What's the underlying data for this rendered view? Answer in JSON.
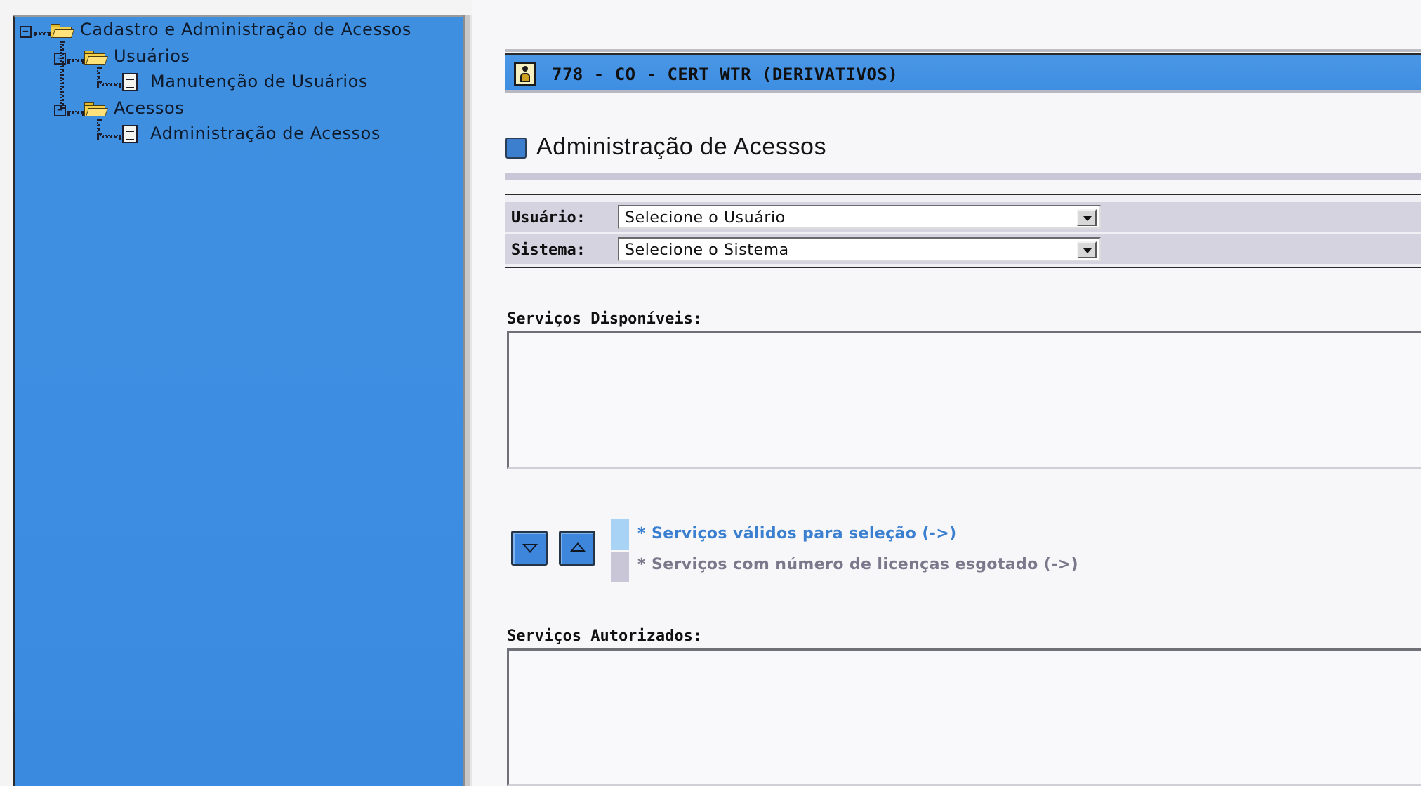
{
  "tree": {
    "root": {
      "toggle": "−",
      "label": "Cadastro e Administração de Acessos"
    },
    "usuarios": {
      "toggle": "−",
      "label": "Usuários"
    },
    "manutencao": {
      "label": "Manutenção de Usuários"
    },
    "acessos": {
      "toggle": "−",
      "label": "Acessos"
    },
    "administracao": {
      "label": "Administração de Acessos"
    }
  },
  "header": {
    "title": "778 - CO - CERT WTR (DERIVATIVOS)",
    "icon": "user-badge-icon"
  },
  "page": {
    "heading": "Administração de Acessos"
  },
  "form": {
    "usuario": {
      "label": "Usuário:",
      "value": "Selecione o Usuário"
    },
    "sistema": {
      "label": "Sistema:",
      "value": "Selecione o Sistema"
    }
  },
  "lists": {
    "disponiveis_label": "Serviços Disponíveis:",
    "autorizados_label": "Serviços Autorizados:"
  },
  "legend": {
    "valid": "* Serviços válidos para seleção (->)",
    "exhausted": "* Serviços com número de licenças esgotado (->)"
  },
  "colors": {
    "tree_background": "#3d8ee2",
    "header_bar": "#3d8ee2",
    "valid_swatch": "#a9d3f5",
    "valid_text": "#3a7fd0",
    "exhausted_swatch": "#c9c6d8",
    "exhausted_text": "#7a788a"
  }
}
